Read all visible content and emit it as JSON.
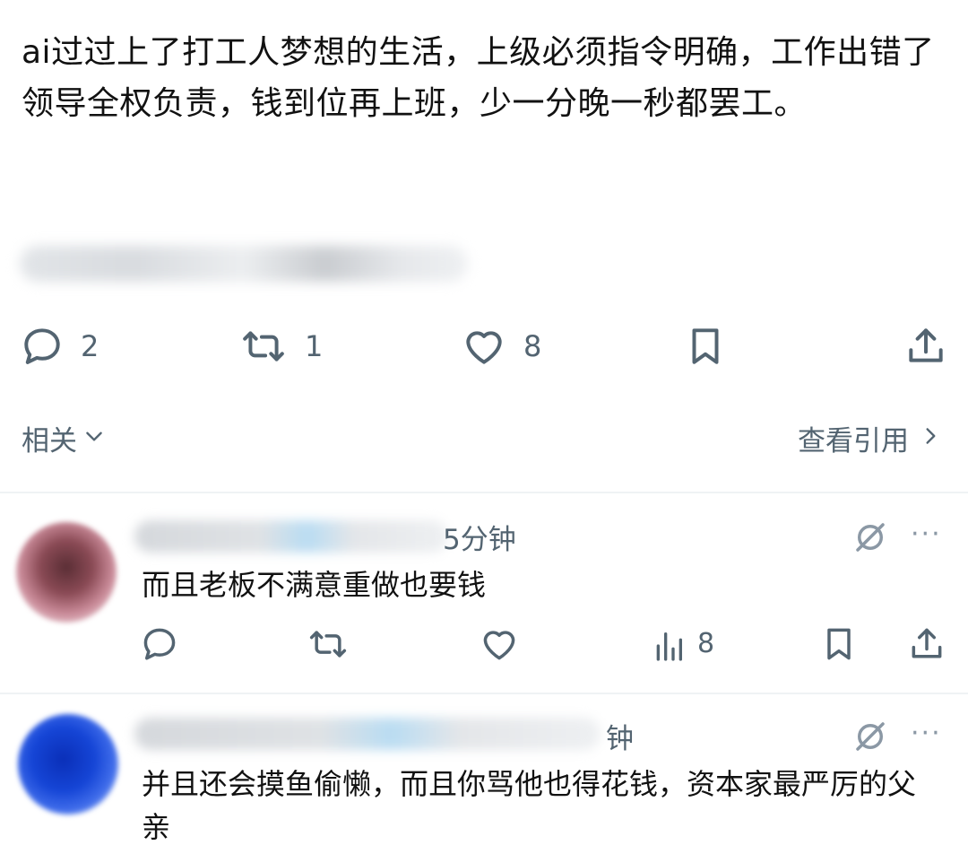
{
  "post": {
    "text": "ai过过上了打工人梦想的生活，上级必须指令明确，工作出错了领导全权负责，钱到位再上班，少一分晚一秒都罢工。"
  },
  "actions": {
    "reply_count": "2",
    "retweet_count": "1",
    "like_count": "8"
  },
  "related": {
    "label": "相关"
  },
  "view_quotes": {
    "label": "查看引用"
  },
  "replies": [
    {
      "time": "5分钟",
      "text": "而且老板不满意重做也要钱",
      "views_count": "8",
      "more": "···"
    },
    {
      "time": "钟",
      "text": "并且还会摸鱼偷懒，而且你骂他也得花钱，资本家最严厉的父亲",
      "more": "···"
    }
  ]
}
